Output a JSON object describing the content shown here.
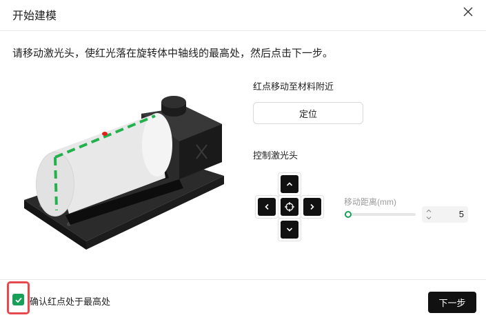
{
  "dialog": {
    "title": "开始建模",
    "close_icon": "close-icon"
  },
  "instruction": "请移动激光头，使红光落在旋转体中轴线的最高处，然后点击下一步。",
  "positioning": {
    "label": "红点移动至材料附近",
    "button_label": "定位"
  },
  "laser_control": {
    "label": "控制激光头",
    "icons": [
      "arrow-up-icon",
      "arrow-left-icon",
      "crosshair-icon",
      "arrow-right-icon",
      "arrow-down-icon"
    ],
    "move_distance_label": "移动距离(mm)",
    "move_distance_value": "5",
    "slider_level_fraction": 0.05
  },
  "footer": {
    "confirm_label": "确认红点处于最高处",
    "confirm_checked": true,
    "next_button_label": "下一步"
  },
  "colors": {
    "accent_green": "#18a058",
    "primary_dark": "#111111",
    "highlight_red": "#e5484d",
    "laser_red": "#e0201a"
  }
}
